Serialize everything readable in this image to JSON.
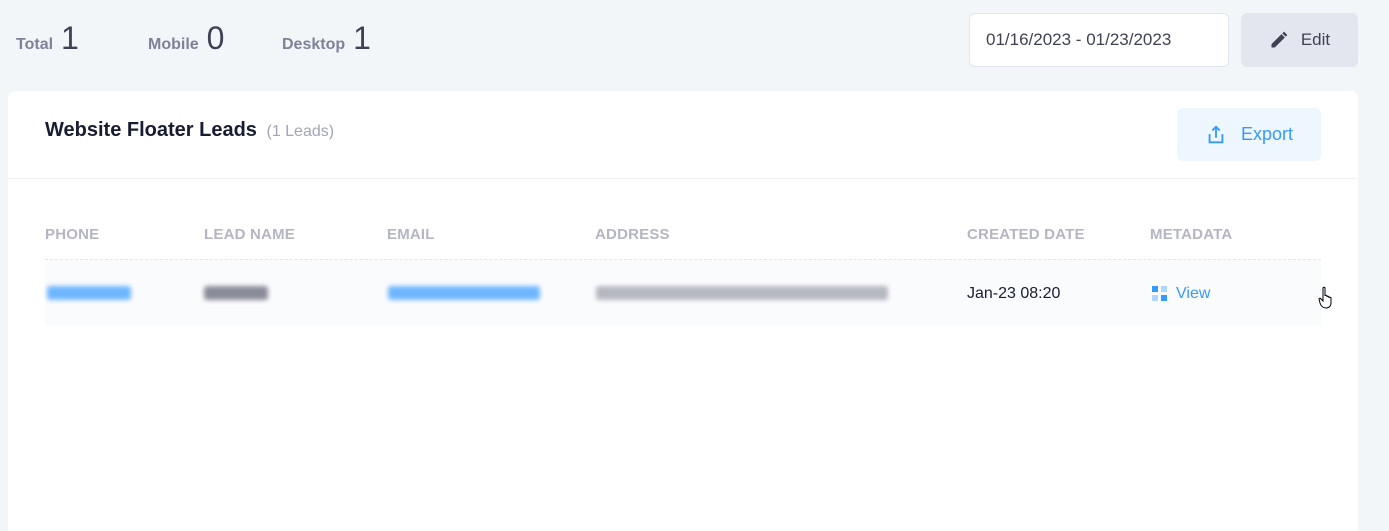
{
  "stats": {
    "total": {
      "label": "Total",
      "value": "1"
    },
    "mobile": {
      "label": "Mobile",
      "value": "0"
    },
    "desktop": {
      "label": "Desktop",
      "value": "1"
    }
  },
  "date_range": {
    "value": "01/16/2023 - 01/23/2023"
  },
  "edit_button": {
    "label": "Edit",
    "icon": "pencil-icon"
  },
  "card": {
    "title": "Website Floater Leads",
    "count": "(1 Leads)",
    "export_label": "Export",
    "export_icon": "export-icon"
  },
  "table": {
    "headers": [
      "PHONE",
      "LEAD NAME",
      "EMAIL",
      "ADDRESS",
      "CREATED DATE",
      "METADATA"
    ],
    "rows": [
      {
        "phone": "",
        "lead_name": "",
        "email": "",
        "address": "",
        "created_date": "Jan-23 08:20",
        "metadata_label": "View"
      }
    ]
  },
  "colors": {
    "accent": "#3699ff",
    "muted": "#b5b5c3",
    "background": "#f3f6f9"
  }
}
